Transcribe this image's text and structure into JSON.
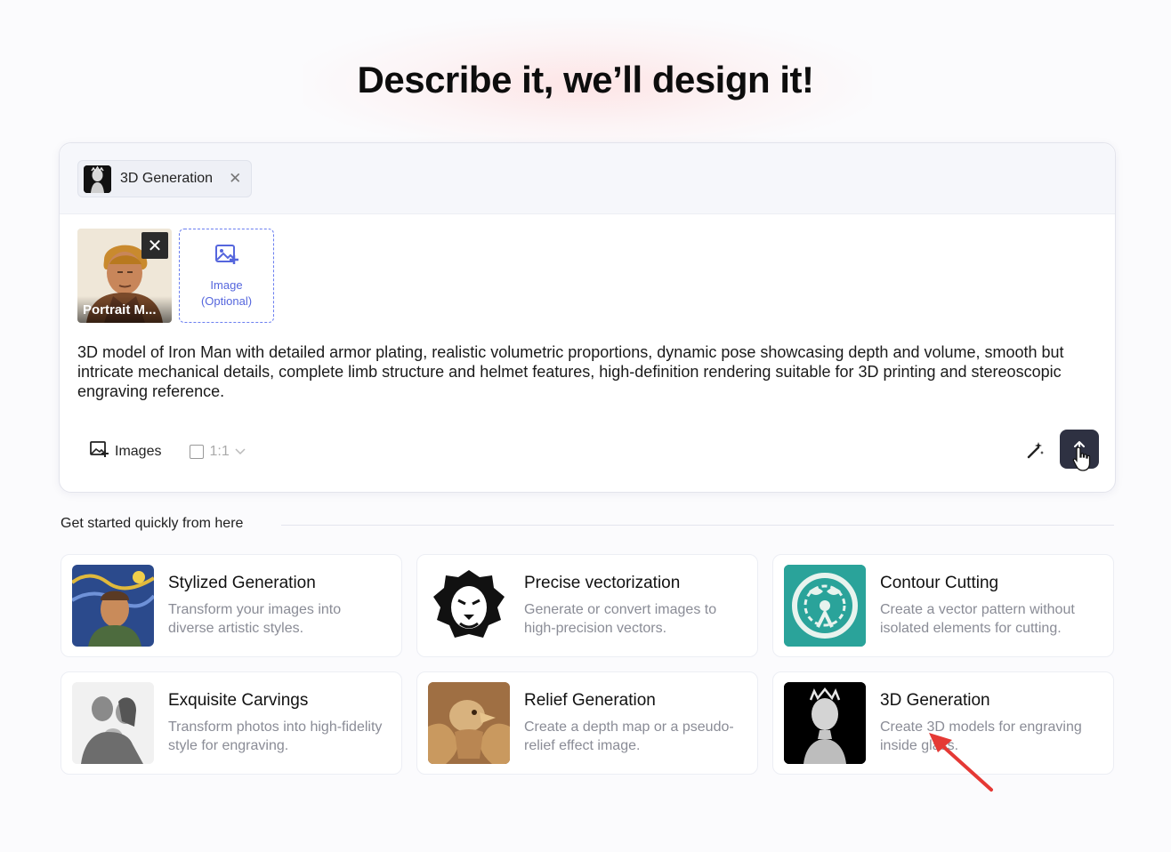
{
  "hero": {
    "title": "Describe it, we’ll design it!"
  },
  "composer": {
    "mode_chip": {
      "label": "3D Generation",
      "icon": "bust-thumbnail",
      "close_icon": "close-icon"
    },
    "attachment": {
      "caption": "Portrait M...",
      "close_icon": "close-icon"
    },
    "upload": {
      "line1": "Image",
      "line2": "(Optional)",
      "icon": "image-add-icon"
    },
    "prompt": "3D model of Iron Man with detailed armor plating, realistic volumetric proportions, dynamic pose showcasing depth and volume, smooth but intricate mechanical details, complete limb structure and helmet features, high-definition rendering suitable for 3D printing and stereoscopic engraving reference.",
    "toolbar": {
      "images_label": "Images",
      "ratio_label": "1:1"
    },
    "send_icon": "arrow-up-icon",
    "magic_icon": "magic-wand-icon"
  },
  "quick_start": {
    "label": "Get started quickly from here",
    "cards": [
      {
        "title": "Stylized Generation",
        "desc": "Transform your images into diverse artistic styles."
      },
      {
        "title": "Precise vectorization",
        "desc": "Generate or convert images to high-precision vectors."
      },
      {
        "title": "Contour Cutting",
        "desc": "Create a vector pattern without isolated elements for cutting."
      },
      {
        "title": "Exquisite Carvings",
        "desc": "Transform photos into high-fidelity style for engraving."
      },
      {
        "title": "Relief Generation",
        "desc": "Create a depth map or a pseudo-relief effect image."
      },
      {
        "title": "3D Generation",
        "desc": "Create 3D models for engraving inside glass."
      }
    ]
  },
  "colors": {
    "accent": "#5566dd",
    "send_bg": "#2e3142",
    "annotation_arrow": "#e53935"
  }
}
